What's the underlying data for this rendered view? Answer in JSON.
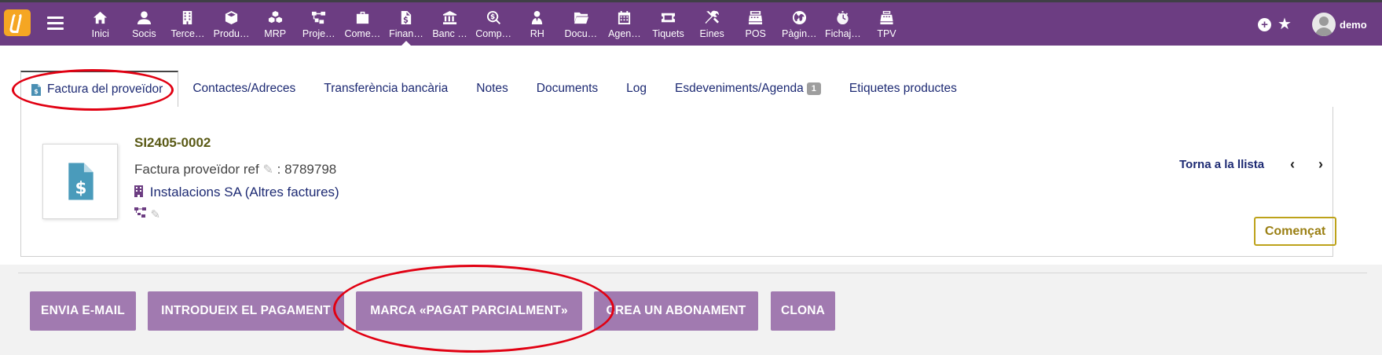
{
  "topbar": {
    "menu": [
      {
        "label": "Inici",
        "icon": "home-icon"
      },
      {
        "label": "Socis",
        "icon": "user-icon"
      },
      {
        "label": "Terce…",
        "icon": "building-icon"
      },
      {
        "label": "Produ…",
        "icon": "cube-icon"
      },
      {
        "label": "MRP",
        "icon": "cubes-icon"
      },
      {
        "label": "Proje…",
        "icon": "sitemap-icon"
      },
      {
        "label": "Come…",
        "icon": "briefcase-icon"
      },
      {
        "label": "Finan…",
        "icon": "file-invoice-icon",
        "active": true
      },
      {
        "label": "Banc …",
        "icon": "bank-icon"
      },
      {
        "label": "Comp…",
        "icon": "search-dollar-icon"
      },
      {
        "label": "RH",
        "icon": "user-tie-icon"
      },
      {
        "label": "Docu…",
        "icon": "folder-icon"
      },
      {
        "label": "Agen…",
        "icon": "calendar-icon"
      },
      {
        "label": "Tiquets",
        "icon": "ticket-icon"
      },
      {
        "label": "Eines",
        "icon": "tools-icon"
      },
      {
        "label": "POS",
        "icon": "cash-register-icon"
      },
      {
        "label": "Pàgin…",
        "icon": "globe-icon"
      },
      {
        "label": "Fichaj…",
        "icon": "clock-icon"
      },
      {
        "label": "TPV",
        "icon": "pos-terminal-icon"
      }
    ],
    "user_name": "demo"
  },
  "tabs": [
    {
      "label": "Factura del proveïdor",
      "active": true
    },
    {
      "label": "Contactes/Adreces"
    },
    {
      "label": "Transferència bancària"
    },
    {
      "label": "Notes"
    },
    {
      "label": "Documents"
    },
    {
      "label": "Log"
    },
    {
      "label": "Esdeveniments/Agenda",
      "badge": "1"
    },
    {
      "label": "Etiquetes productes"
    }
  ],
  "invoice": {
    "ref": "SI2405-0002",
    "supplier_ref_label": "Factura proveïdor ref",
    "supplier_ref_value": ": 8789798",
    "thirdparty_name": "Instalacions SA",
    "thirdparty_category": "(Altres factures)",
    "back_to_list": "Torna a la llista",
    "status": "Començat"
  },
  "actions": [
    "ENVIA E-MAIL",
    "INTRODUEIX EL PAGAMENT",
    "MARCA «PAGAT PARCIALMENT»",
    "CREA UN ABONAMENT",
    "CLONA"
  ],
  "colors": {
    "topbar": "#6c3d82",
    "button": "#a17ab0",
    "link": "#1d2a73",
    "status_border": "#bda21a",
    "annotation": "#e10012"
  }
}
